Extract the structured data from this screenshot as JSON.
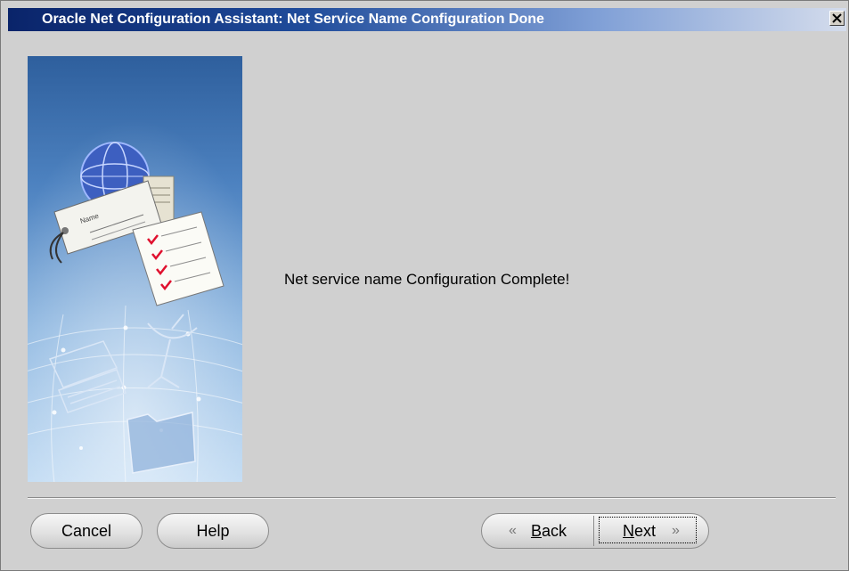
{
  "window": {
    "title": "Oracle Net Configuration Assistant: Net Service Name Configuration Done",
    "close_label": "✕"
  },
  "main": {
    "message": "Net service name Configuration Complete!"
  },
  "buttons": {
    "cancel": "Cancel",
    "help": "Help",
    "back_mnemonic": "B",
    "back_rest": "ack",
    "next_mnemonic": "N",
    "next_rest": "ext",
    "back_arrow": "«",
    "next_arrow": "»"
  },
  "illustration": {
    "card_text": "Name"
  },
  "colors": {
    "titlebar_start": "#0a246a",
    "panel_bg": "#d0d0d0",
    "check_mark": "#e0102e"
  }
}
